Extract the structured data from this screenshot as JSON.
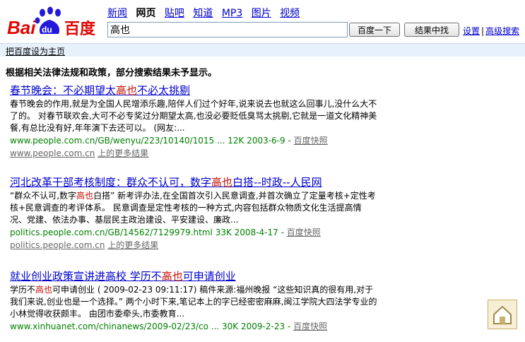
{
  "logo": {
    "text_left": "Bai",
    "text_paw": "du",
    "text_right": "百度"
  },
  "nav": [
    "新闻",
    "网页",
    "贴吧",
    "知道",
    "MP3",
    "图片",
    "视频"
  ],
  "nav_active_index": 1,
  "search": {
    "query": "高也",
    "button_search": "百度一下",
    "button_within": "结果中找"
  },
  "top_links": {
    "settings": "设置",
    "separator": "|",
    "advanced": "高级搜索"
  },
  "subbar": {
    "set_home": "把百度设为主页"
  },
  "notice": "根据相关法律法规和政策，部分搜索结果未予显示。",
  "results": [
    {
      "title_before": "春节晚会：不必期望太",
      "title_hl": "高也",
      "title_after": "不必太挑剔",
      "snippet": "春节晚会的作用,就是为全国人民增添乐趣,陪伴人们过个好年,说来说去也就这么回事儿,没什么大不了的。 对春节联欢会,大可不必专奖过分期望太高,也没必要贬低臭骂太挑剔,它就是一道文化精神美餐,有总比没有好,年年演下去还可以。 (网友:...",
      "url": "www.people.com.cn/GB/wenyu/223/10140/1015 ... 12K 2003-6-9 - ",
      "cache": "百度快照",
      "more_site": "www.people.com.cn",
      "more_text": "上的更多结果"
    },
    {
      "title_before": "河北改革干部考核制度：群众不认可，数字",
      "title_hl": "高也",
      "title_after": "白搭--时政--人民网",
      "snippet_before": "“群众不认可,数字",
      "snippet_hl": "高也",
      "snippet_after": "白搭” 新考评办法,在全国首次引入民意调查,并首次确立了定量考核+定性考核+民意调查的考评体系。 民意调查是定性考核的一种方式,内容包括群众物质文化生活提高情况、党建、依法办事、基层民主政治建设、平安建设、廉政...",
      "url": "politics.people.com.cn/GB/14562/7129979.html 33K 2008-4-17 - ",
      "cache": "百度快照",
      "more_site": "politics.people.com.cn",
      "more_text": "上的更多结果"
    },
    {
      "title_before": "就业创业政策宣讲进高校 学历不",
      "title_hl": "高也",
      "title_after": "可申请创业",
      "snippet_before": "学历不",
      "snippet_hl": "高也",
      "snippet_after": "可申请创业 ( 2009-02-23 09:11:17) 稿件来源:福州晚报 “这些知识真的很有用,对于我们来说,创业也是一个选择。” 两个小时下来,笔记本上的字已经密密麻麻,闽江学院大四法学专业的小林觉得收获颇丰。 由团市委牵头,市委教育...",
      "url": "www.xinhuanet.com/chinanews/2009-02/23/co ... 30K 2009-2-23 - ",
      "cache": "百度快照"
    }
  ],
  "colors": {
    "link": "#0000cc",
    "highlight": "#c60a00",
    "url_green": "#008000",
    "logo_red": "#e10602",
    "logo_blue": "#2319dc"
  }
}
